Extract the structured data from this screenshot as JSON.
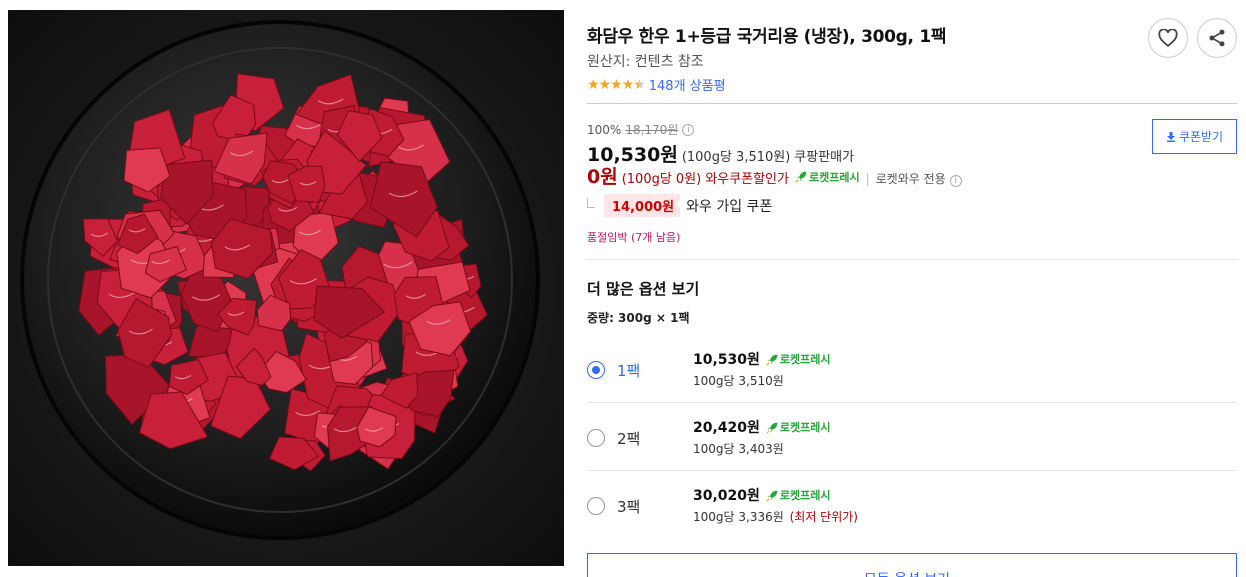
{
  "product": {
    "title": "화담우 한우 1+등급 국거리용 (냉장), 300g, 1팩",
    "origin": "원산지: 컨텐츠 참조",
    "rating_stars": "★★★★",
    "rating_half_star": "★",
    "review_count": "148개 상품평",
    "image_icon": "beef-cubes-plate"
  },
  "actions": {
    "heart_icon": "heart-icon",
    "share_icon": "share-icon"
  },
  "pricing": {
    "discount_rate": "100%",
    "original_price": "18,170원",
    "info_icon": "i",
    "sale_price": "10,530원",
    "sale_unit_price": "(100g당 3,510원)",
    "sale_price_type": "쿠팡판매가",
    "wow_price": "0원",
    "wow_unit_price": "(100g당 0원)",
    "wow_price_type": "와우쿠폰할인가",
    "rocket_label": "로켓프레시",
    "separator": "|",
    "wow_only": "로켓와우 전용",
    "coupon_amount": "14,000원",
    "coupon_desc": "와우 가입 쿠폰",
    "stock_warning": "품절임박 (7개 남음)",
    "coupon_button": "쿠폰받기"
  },
  "options": {
    "heading": "더 많은 옵션 보기",
    "weight_label": "중량: 300g × 1팩",
    "items": [
      {
        "name": "1팩",
        "price": "10,530원",
        "badge": "로켓프레시",
        "unit": "100g당 3,510원",
        "note": ""
      },
      {
        "name": "2팩",
        "price": "20,420원",
        "badge": "로켓프레시",
        "unit": "100g당 3,403원",
        "note": ""
      },
      {
        "name": "3팩",
        "price": "30,020원",
        "badge": "로켓프레시",
        "unit": "100g당 3,336원",
        "note": "(최저 단위가)"
      }
    ],
    "all_options_button": "모든 옵션 보기 ›"
  },
  "colors": {
    "accent_blue": "#346aff",
    "wow_red": "#ae0000",
    "rocket_green": "#26a539",
    "star_orange": "#f5a623"
  }
}
